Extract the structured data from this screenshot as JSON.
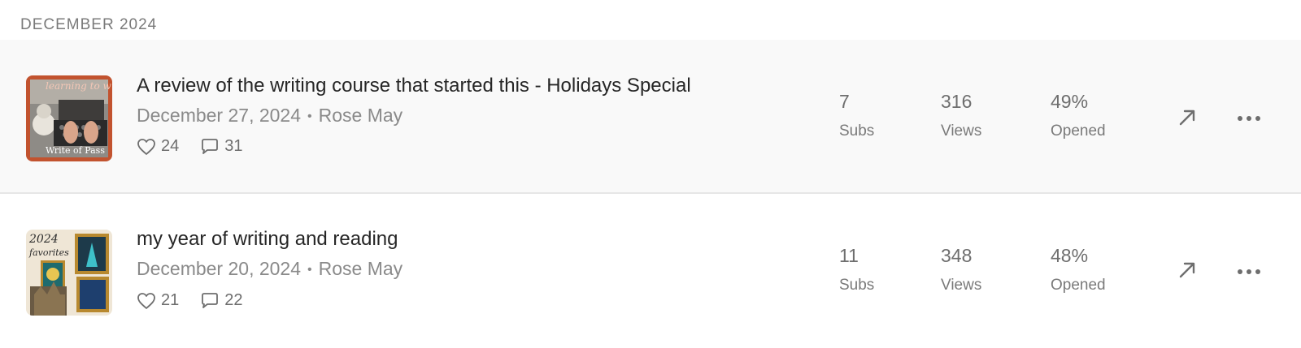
{
  "section": {
    "header": "DECEMBER 2024"
  },
  "posts": [
    {
      "title": "A review of the writing course that started this - Holidays Special",
      "date": "December 27, 2024",
      "author": "Rose May",
      "separator": "•",
      "likes": "24",
      "comments": "31",
      "thumbnail_text_top": "learning to w",
      "thumbnail_text_bottom": "Write of Pass",
      "stats": {
        "subs_value": "7",
        "subs_label": "Subs",
        "views_value": "316",
        "views_label": "Views",
        "opened_value": "49%",
        "opened_label": "Opened"
      }
    },
    {
      "title": "my year of writing and reading",
      "date": "December 20, 2024",
      "author": "Rose May",
      "separator": "•",
      "likes": "21",
      "comments": "22",
      "thumbnail_text_top": "2024 favorites",
      "thumbnail_text_bottom": "",
      "stats": {
        "subs_value": "11",
        "subs_label": "Subs",
        "views_value": "348",
        "views_label": "Views",
        "opened_value": "48%",
        "opened_label": "Opened"
      }
    }
  ],
  "icons": {
    "like": "heart-icon",
    "comment": "speech-bubble-icon",
    "open": "arrow-up-right-icon",
    "more": "ellipsis-icon"
  },
  "colors": {
    "highlight_row": "#f9f9f9",
    "divider": "#e6e6e6",
    "text_primary": "#262626",
    "text_secondary": "#8a8a8a"
  }
}
